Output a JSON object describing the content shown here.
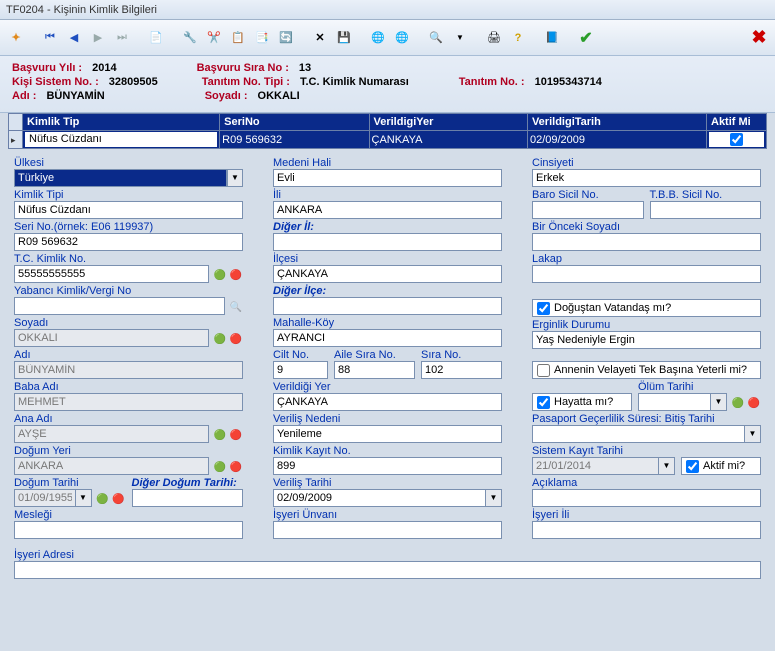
{
  "window": {
    "title": "TF0204 - Kişinin Kimlik Bilgileri"
  },
  "info": {
    "basvuru_yili_l": "Başvuru Yılı :",
    "basvuru_yili": "2014",
    "basvuru_sira_l": "Başvuru Sıra No :",
    "basvuru_sira": "13",
    "kisi_sistem_l": "Kişi Sistem No. :",
    "kisi_sistem": "32809505",
    "tanitim_tipi_l": "Tanıtım No. Tipi :",
    "tanitim_tipi": "T.C. Kimlik Numarası",
    "tanitim_no_l": "Tanıtım No. :",
    "tanitim_no": "10195343714",
    "adi_l": "Adı :",
    "adi": "BÜNYAMİN",
    "soyadi_l": "Soyadı :",
    "soyadi": "OKKALI"
  },
  "grid": {
    "h1": "Kimlik Tip",
    "h2": "SeriNo",
    "h3": "VerildigiYer",
    "h4": "VerildigiTarih",
    "h5": "Aktif Mi",
    "r": {
      "c1": "Nüfus Cüzdanı",
      "c2": "R09 569632",
      "c3": "ÇANKAYA",
      "c4": "02/09/2009",
      "c5": true
    }
  },
  "labels": {
    "ulkesi": "Ülkesi",
    "kimlik_tipi": "Kimlik Tipi",
    "seri_no": "Seri No.(örnek: E06 119937)",
    "tc": "T.C. Kimlik No.",
    "yabanci": "Yabancı Kimlik/Vergi No",
    "soyadi": "Soyadı",
    "adi": "Adı",
    "baba": "Baba Adı",
    "ana": "Ana Adı",
    "dogum_yeri": "Doğum Yeri",
    "dogum_tarihi": "Doğum Tarihi",
    "diger_dogum": "Diğer Doğum Tarihi:",
    "meslegi": "Mesleği",
    "medeni": "Medeni Hali",
    "ili": "İli",
    "diger_il": "Diğer İl:",
    "ilcesi": "İlçesi",
    "diger_ilce": "Diğer İlçe:",
    "mahalle": "Mahalle-Köy",
    "cilt": "Cilt No.",
    "aile": "Aile Sıra No.",
    "sira": "Sıra No.",
    "verildigi_yer": "Verildiği Yer",
    "verilis_nedeni": "Veriliş Nedeni",
    "kimlik_kayit": "Kimlik Kayıt No.",
    "verilis_tarihi": "Veriliş Tarihi",
    "isyeri_unvan": "İşyeri Ünvanı",
    "cinsiyeti": "Cinsiyeti",
    "baro": "Baro Sicil No.",
    "tbb": "T.B.B. Sicil No.",
    "bir_onceki": "Bir Önceki Soyadı",
    "lakap": "Lakap",
    "dogustan": "Doğuştan Vatandaş mı?",
    "erginlik": "Erginlik Durumu",
    "annenin": "Annenin Velayeti Tek Başına Yeterli mi?",
    "hayatta": "Hayatta mı?",
    "olum": "Ölüm Tarihi",
    "pasaport": "Pasaport Geçerlilik Süresi: Bitiş Tarihi",
    "sistem_kayit": "Sistem Kayıt Tarihi",
    "aktif": "Aktif mi?",
    "aciklama": "Açıklama",
    "isyeri_ili": "İşyeri İli",
    "isyeri_adresi": "İşyeri Adresi"
  },
  "values": {
    "ulkesi": "Türkiye",
    "kimlik_tipi": "Nüfus Cüzdanı",
    "seri_no": "R09 569632",
    "tc": "55555555555",
    "yabanci": "",
    "soyadi": "OKKALI",
    "adi": "BÜNYAMİN",
    "baba": "MEHMET",
    "ana": "AYŞE",
    "dogum_yeri": "ANKARA",
    "dogum_tarihi": "01/09/1955",
    "diger_dogum": "",
    "meslegi": "",
    "medeni": "Evli",
    "ili": "ANKARA",
    "diger_il": "",
    "ilcesi": "ÇANKAYA",
    "diger_ilce": "",
    "mahalle": "AYRANCI",
    "cilt": "9",
    "aile": "88",
    "sira": "102",
    "verildigi_yer": "ÇANKAYA",
    "verilis_nedeni": "Yenileme",
    "kimlik_kayit": "899",
    "verilis_tarihi": "02/09/2009",
    "isyeri_unvan": "",
    "cinsiyeti": "Erkek",
    "baro": "",
    "tbb": "",
    "bir_onceki": "",
    "lakap": "",
    "dogustan": true,
    "erginlik": "Yaş Nedeniyle Ergin",
    "annenin": false,
    "hayatta": true,
    "olum": "",
    "pasaport": "",
    "sistem_kayit": "21/01/2014",
    "aktif": true,
    "aciklama": "",
    "isyeri_ili": "",
    "isyeri_adresi": ""
  }
}
